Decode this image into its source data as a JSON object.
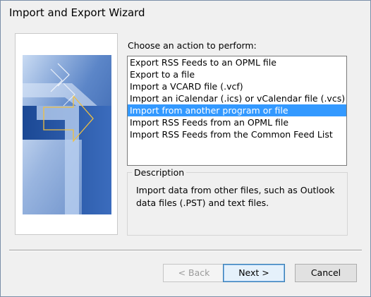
{
  "window": {
    "title": "Import and Export Wizard"
  },
  "choose_label": "Choose an action to perform:",
  "actions": [
    "Export RSS Feeds to an OPML file",
    "Export to a file",
    "Import a VCARD file (.vcf)",
    "Import an iCalendar (.ics) or vCalendar file (.vcs)",
    "Import from another program or file",
    "Import RSS Feeds from an OPML file",
    "Import RSS Feeds from the Common Feed List"
  ],
  "selected_index": 4,
  "description": {
    "label": "Description",
    "text": "Import data from other files, such as Outlook data files (.PST) and text files."
  },
  "buttons": {
    "back": "< Back",
    "next": "Next >",
    "cancel": "Cancel"
  },
  "colors": {
    "selection": "#3399ff",
    "art_dark": "#1e4c9a",
    "art_light": "#a9c3e8"
  }
}
